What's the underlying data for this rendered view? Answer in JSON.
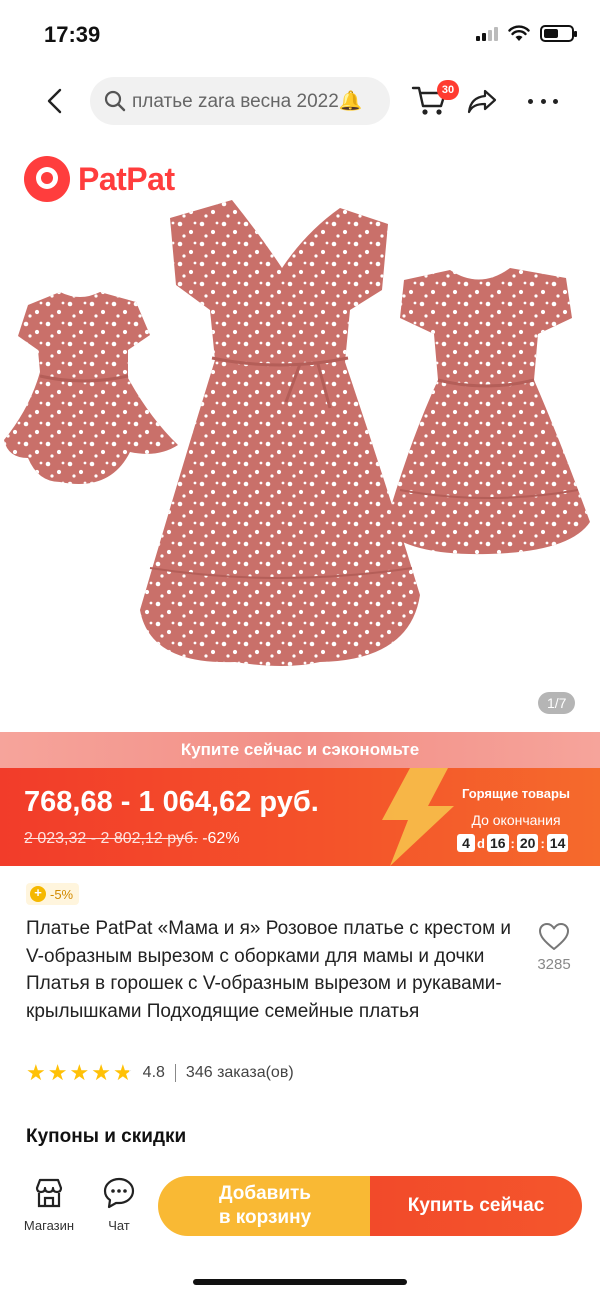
{
  "status_bar": {
    "time": "17:39"
  },
  "top_nav": {
    "search_query": "платье zara весна 2022🔔",
    "cart_count": "30"
  },
  "product_image": {
    "brand": "PatPat",
    "counter": "1/7",
    "dress_color": "#c9706a"
  },
  "promo": {
    "text": "Купите сейчас и сэкономьте"
  },
  "price": {
    "current": "768,68 - 1 064,62 руб.",
    "old": "2 023,32 - 2 802,12 руб.",
    "discount": "-62%",
    "hot_label": "Горящие товары",
    "ends_label": "До окончания",
    "countdown": {
      "days": "4",
      "d": "d",
      "hours": "16",
      "minutes": "20",
      "seconds": "14"
    }
  },
  "badge": {
    "text": "-5%"
  },
  "product": {
    "title": "Платье PatPat «Мама и я» Розовое платье с крестом и V-образным вырезом с оборками для мамы и дочки Платья в горошек с V-образным вырезом и рукавами-крылышками Подходящие семейные платья",
    "favorites": "3285",
    "rating": "4.8",
    "rating_stars": 4.8,
    "orders": "346 заказа(ов)"
  },
  "sections": {
    "coupons_title": "Купоны и скидки"
  },
  "bottom_bar": {
    "store_label": "Магазин",
    "chat_label": "Чат",
    "add_to_cart_line1": "Добавить",
    "add_to_cart_line2": "в корзину",
    "buy_now": "Купить сейчас"
  },
  "colors": {
    "accent_red": "#f23c2a",
    "accent_yellow": "#f9b934",
    "brand_red": "#ff3d3d"
  }
}
